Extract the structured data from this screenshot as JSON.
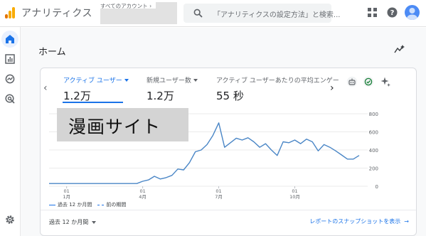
{
  "header": {
    "app_title": "アナリティクス",
    "account_label": "すべてのアカウント",
    "account_chevron": "›",
    "search_placeholder": "「アナリティクスの設定方法」と検索..."
  },
  "page": {
    "title": "ホーム"
  },
  "card": {
    "prev": "‹",
    "next": "›",
    "metrics": [
      {
        "label": "アクティブ ユーザー",
        "value": "1.2万",
        "active": true
      },
      {
        "label": "新規ユーザー数",
        "value": "1.2万",
        "active": false
      },
      {
        "label": "アクティブ ユーザーあたりの平均エンゲー",
        "value": "55 秒",
        "active": false
      }
    ],
    "legend": [
      {
        "label": "過去 12 か月間",
        "style": "solid"
      },
      {
        "label": "前の期間",
        "style": "dashed"
      }
    ],
    "period_label": "過去 12 か月間",
    "snapshot_link": "レポートのスナップショットを表示",
    "snapshot_arrow": "→"
  },
  "overlay": {
    "text": "漫画サイト"
  },
  "colors": {
    "accent": "#1a73e8",
    "line": "#4a86c6",
    "grid": "#e5e5e5",
    "logo_orange": "#f9ab00",
    "logo_dark": "#e37400"
  },
  "chart_data": {
    "type": "line",
    "x_ticks": [
      {
        "label": "01\n1月",
        "index": 3
      },
      {
        "label": "01\n4月",
        "index": 16
      },
      {
        "label": "01\n7月",
        "index": 29
      },
      {
        "label": "01\n10月",
        "index": 42
      }
    ],
    "y_ticks": [
      0,
      200,
      400,
      600,
      800
    ],
    "ylim": [
      0,
      800
    ],
    "series": [
      {
        "name": "過去 12 か月間",
        "values": [
          30,
          30,
          30,
          30,
          30,
          30,
          30,
          30,
          30,
          30,
          30,
          30,
          30,
          30,
          30,
          30,
          55,
          70,
          110,
          80,
          95,
          120,
          190,
          180,
          260,
          380,
          400,
          460,
          560,
          700,
          430,
          480,
          530,
          510,
          535,
          490,
          430,
          470,
          400,
          340,
          490,
          480,
          510,
          470,
          520,
          490,
          390,
          460,
          430,
          390,
          345,
          300,
          300,
          340
        ]
      }
    ]
  }
}
